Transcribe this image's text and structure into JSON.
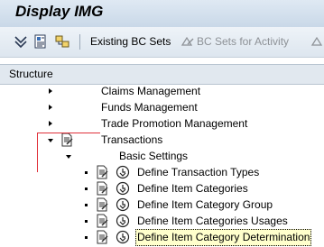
{
  "window": {
    "title": "Display IMG"
  },
  "toolbar": {
    "icons": [
      "filter-expand-icon",
      "documentation-icon",
      "where-used-icon"
    ],
    "existing_bc_sets": "Existing BC Sets",
    "bc_sets_for_activity": "BC Sets for Activity"
  },
  "structure": {
    "header": "Structure",
    "nodes": [
      {
        "label": "Claims Management",
        "expanded": false
      },
      {
        "label": "Funds Management",
        "expanded": false
      },
      {
        "label": "Trade Promotion Management",
        "expanded": false
      },
      {
        "label": "Transactions",
        "expanded": true
      },
      {
        "label": "Basic Settings",
        "expanded": true
      }
    ],
    "activities": [
      {
        "label": "Define Transaction Types"
      },
      {
        "label": "Define Item Categories"
      },
      {
        "label": "Define Item Category Group"
      },
      {
        "label": "Define Item Categories Usages"
      },
      {
        "label": "Define Item Category Determination",
        "selected": true
      }
    ]
  },
  "colors": {
    "annotation_line": "#e0303a",
    "selection": "#ffffcc"
  }
}
